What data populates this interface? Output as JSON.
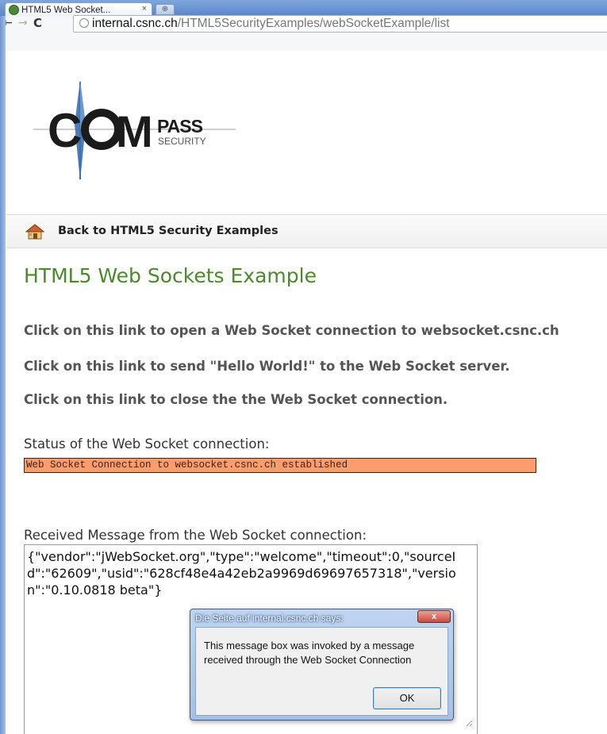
{
  "browser": {
    "tab_title": "HTML5 Web Socket...",
    "tab_close": "×",
    "url_host": "internal.csnc.ch",
    "url_path": "/HTML5SecurityExamples/webSocketExample/list"
  },
  "logo": {
    "letters_left": "C",
    "letters_mid": "M",
    "pass": "PASS",
    "security": "SECURITY"
  },
  "nav": {
    "back_link": "Back to HTML5 Security Examples"
  },
  "page": {
    "heading": "HTML5 Web Sockets Example",
    "links": [
      "Click on this link to open a Web Socket connection to websocket.csnc.ch",
      "Click on this link to send \"Hello World!\" to the Web Socket server.",
      "Click on this link to close the the Web Socket connection."
    ],
    "status_label": "Status of the Web Socket connection:",
    "status_text": "Web Socket Connection to websocket.csnc.ch established",
    "received_label": "Received Message from the Web Socket connection:",
    "received_message": "{\"vendor\":\"jWebSocket.org\",\"type\":\"welcome\",\"timeout\":0,\"sourceId\":\"62609\",\"usid\":\"628cf48e4a42eb2a9969d69697657318\",\"version\":\"0.10.0818 beta\"}"
  },
  "dialog": {
    "title": "Die Seite auf internal.csnc.ch says:",
    "close": "x",
    "message": "This message box was invoked by a message received through the Web Socket Connection",
    "ok_label": "OK"
  },
  "colors": {
    "heading_green": "#4a8a2a",
    "status_bg": "#fd9c6c",
    "logo_dark": "#1b1b1b",
    "logo_blue": "#3b6fb0"
  }
}
